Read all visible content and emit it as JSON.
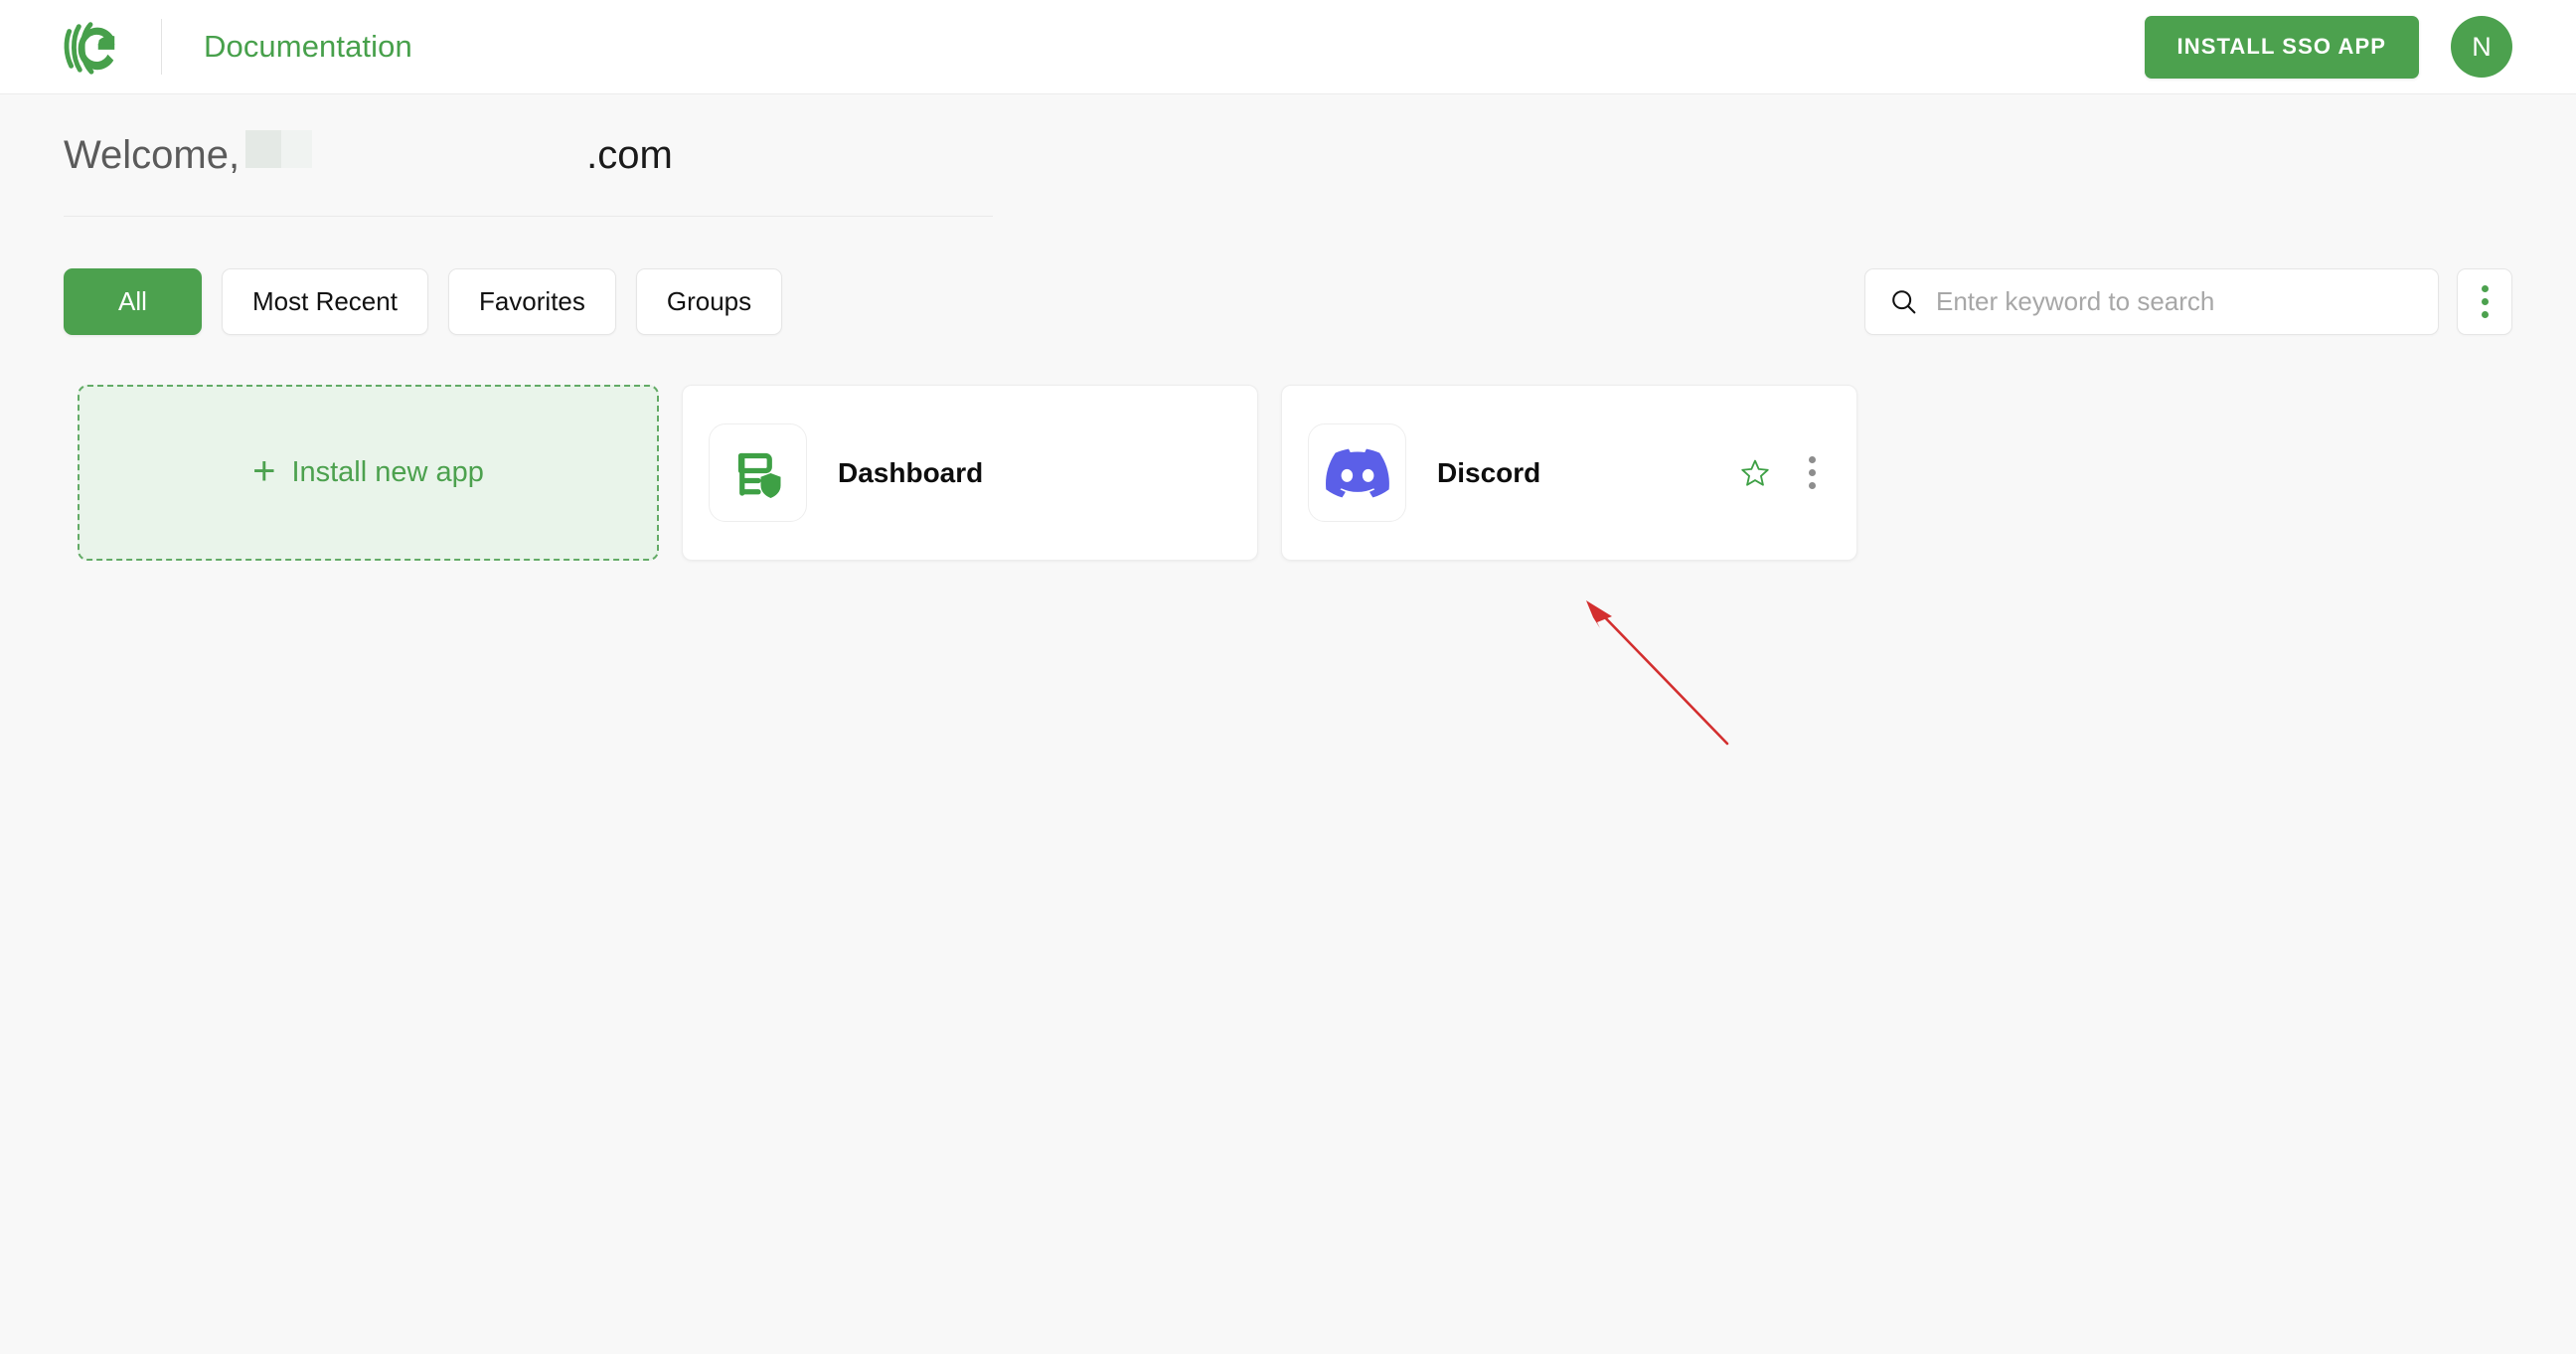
{
  "header": {
    "logo_icon": "miniorange-logo-icon",
    "title": "Documentation",
    "install_sso_label": "INSTALL SSO APP",
    "avatar_initial": "N"
  },
  "welcome": {
    "greeting": "Welcome,",
    "redacted": "",
    "domain": ".com"
  },
  "filters": {
    "tabs": [
      {
        "label": "All",
        "active": true
      },
      {
        "label": "Most Recent",
        "active": false
      },
      {
        "label": "Favorites",
        "active": false
      },
      {
        "label": "Groups",
        "active": false
      }
    ],
    "search": {
      "icon": "search-icon",
      "placeholder": "Enter keyword to search",
      "value": ""
    },
    "overflow_icon": "kebab-menu-icon"
  },
  "apps": {
    "install_new": {
      "plus_icon": "plus-icon",
      "label": "Install new app"
    },
    "cards": [
      {
        "name": "Dashboard",
        "icon": "dashboard-shield-icon",
        "icon_color": "#4ca14e",
        "has_star": false,
        "has_menu": false
      },
      {
        "name": "Discord",
        "icon": "discord-icon",
        "icon_color": "#5865f2",
        "has_star": true,
        "has_menu": true,
        "star_icon": "star-outline-icon",
        "menu_icon": "kebab-menu-icon"
      }
    ]
  },
  "annotation": {
    "type": "arrow",
    "color": "#d32f2f",
    "points_to": "Discord card"
  },
  "colors": {
    "brand_green": "#4ca14e",
    "page_background": "#f8f8f8",
    "card_background": "#ffffff",
    "discord_blurple": "#5865f2",
    "annotation_red": "#d32f2f"
  }
}
